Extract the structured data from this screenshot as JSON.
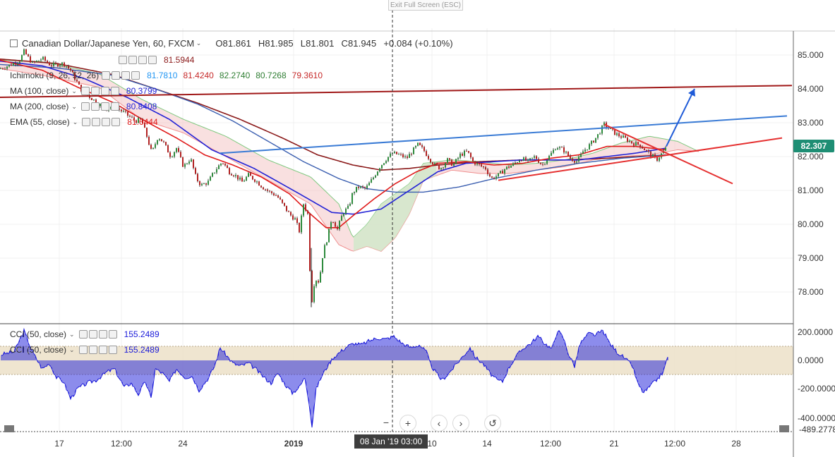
{
  "header": {
    "exit_fullscreen": "Exit Full Screen (ESC)",
    "symbol": "Canadian Dollar/Japanese Yen, 60, FXCM",
    "open": "O81.861",
    "high": "H81.985",
    "low": "L81.801",
    "close": "C81.945",
    "change": "+0.084 (+0.10%)"
  },
  "indicators": {
    "row1": {
      "value": "81.5944"
    },
    "ichimoku": {
      "name": "Ichimoku (9, 26, 52, 26)",
      "values": [
        "81.7810",
        "81.4240",
        "82.2740",
        "80.7268",
        "79.3610"
      ],
      "colors": [
        "#2196f3",
        "#c62828",
        "#2e7d32",
        "#2e7d32",
        "#c62828"
      ]
    },
    "ma100": {
      "name": "MA (100, close)",
      "value": "80.3799"
    },
    "ma200": {
      "name": "MA (200, close)",
      "value": "80.8408"
    },
    "ema55": {
      "name": "EMA (55, close)",
      "value": "81.6444"
    },
    "cci1": {
      "name": "CCI (50, close)",
      "value": "155.2489"
    },
    "cci2": {
      "name": "CCI (50, close)",
      "value": "155.2489"
    }
  },
  "price_axis": {
    "ticks": [
      "85.000",
      "84.000",
      "83.000",
      "82.000",
      "81.000",
      "80.000",
      "79.000",
      "78.000"
    ],
    "current": "82.307",
    "current_color": "#1e8e74"
  },
  "cci_axis": {
    "ticks": [
      "200.0000",
      "0.0000",
      "-200.0000",
      "-400.0000",
      "-489.2778"
    ]
  },
  "time_axis": {
    "labels": [
      "17",
      "12:00",
      "24",
      "2019",
      "10",
      "14",
      "12:00",
      "21",
      "12:00",
      "28"
    ],
    "crosshair_label": "08 Jan '19   03:00"
  },
  "nav_buttons": [
    "−",
    "+",
    "‹",
    "›",
    "↺"
  ],
  "colors": {
    "ma100": "#2323d6",
    "ma200": "#8b1a1a",
    "ema55": "#e01b1b",
    "cci": "#1a1ad9",
    "trend_blue": "#3a7bd5",
    "trend_dark": "#a01818",
    "trend_red": "#e53030",
    "band": "#ece0c8"
  },
  "chart_data": {
    "type": "candlestick",
    "instrument": "Canadian Dollar/Japanese Yen",
    "timeframe": "60",
    "ylim": [
      77.4,
      85.2
    ],
    "cci_ylim": [
      -489.2778,
      230
    ],
    "anchors": [
      [
        0,
        84.6
      ],
      [
        14,
        84.7
      ],
      [
        28,
        84.85
      ],
      [
        34,
        85.1
      ],
      [
        46,
        84.75
      ],
      [
        60,
        84.9
      ],
      [
        72,
        84.7
      ],
      [
        90,
        84.75
      ],
      [
        100,
        84.55
      ],
      [
        114,
        84.0
      ],
      [
        128,
        83.75
      ],
      [
        140,
        83.55
      ],
      [
        150,
        83.4
      ],
      [
        160,
        83.5
      ],
      [
        172,
        83.35
      ],
      [
        182,
        83.2
      ],
      [
        192,
        83.05
      ],
      [
        200,
        83.1
      ],
      [
        208,
        82.6
      ],
      [
        215,
        82.1
      ],
      [
        224,
        82.6
      ],
      [
        232,
        82.4
      ],
      [
        242,
        82.0
      ],
      [
        250,
        82.25
      ],
      [
        260,
        81.7
      ],
      [
        270,
        81.95
      ],
      [
        278,
        81.35
      ],
      [
        285,
        81.15
      ],
      [
        295,
        81.25
      ],
      [
        305,
        81.6
      ],
      [
        315,
        81.85
      ],
      [
        325,
        81.55
      ],
      [
        333,
        81.45
      ],
      [
        343,
        81.25
      ],
      [
        352,
        81.45
      ],
      [
        362,
        81.3
      ],
      [
        372,
        81.1
      ],
      [
        382,
        80.95
      ],
      [
        392,
        80.85
      ],
      [
        400,
        80.6
      ],
      [
        410,
        80.3
      ],
      [
        418,
        80.15
      ],
      [
        424,
        79.8
      ],
      [
        430,
        80.6
      ],
      [
        436,
        80.3
      ],
      [
        441,
        77.6
      ],
      [
        446,
        78.4
      ],
      [
        452,
        78.3
      ],
      [
        458,
        79.2
      ],
      [
        464,
        79.6
      ],
      [
        470,
        80.2
      ],
      [
        478,
        79.85
      ],
      [
        486,
        80.35
      ],
      [
        494,
        80.5
      ],
      [
        500,
        80.95
      ],
      [
        508,
        81.1
      ],
      [
        518,
        81.05
      ],
      [
        528,
        81.35
      ],
      [
        538,
        81.7
      ],
      [
        548,
        81.95
      ],
      [
        556,
        82.1
      ],
      [
        566,
        82.05
      ],
      [
        576,
        81.95
      ],
      [
        584,
        82.15
      ],
      [
        592,
        82.35
      ],
      [
        600,
        82.2
      ],
      [
        608,
        81.95
      ],
      [
        616,
        81.75
      ],
      [
        624,
        81.65
      ],
      [
        634,
        81.9
      ],
      [
        642,
        81.75
      ],
      [
        652,
        82.05
      ],
      [
        662,
        82.15
      ],
      [
        670,
        81.85
      ],
      [
        678,
        81.75
      ],
      [
        688,
        81.65
      ],
      [
        696,
        81.35
      ],
      [
        706,
        81.45
      ],
      [
        716,
        81.65
      ],
      [
        726,
        81.75
      ],
      [
        738,
        81.95
      ],
      [
        748,
        81.85
      ],
      [
        758,
        82.0
      ],
      [
        768,
        81.75
      ],
      [
        778,
        82.0
      ],
      [
        788,
        82.3
      ],
      [
        798,
        82.2
      ],
      [
        808,
        81.95
      ],
      [
        818,
        81.85
      ],
      [
        826,
        82.15
      ],
      [
        836,
        82.35
      ],
      [
        846,
        82.6
      ],
      [
        856,
        82.95
      ],
      [
        864,
        82.8
      ],
      [
        874,
        82.65
      ],
      [
        884,
        82.55
      ],
      [
        896,
        82.4
      ],
      [
        906,
        82.35
      ],
      [
        914,
        82.2
      ],
      [
        922,
        82.05
      ],
      [
        930,
        81.9
      ],
      [
        936,
        82.05
      ],
      [
        944,
        82.25
      ]
    ],
    "cci_anchors": [
      [
        0,
        40
      ],
      [
        20,
        60
      ],
      [
        34,
        210
      ],
      [
        46,
        60
      ],
      [
        60,
        -60
      ],
      [
        70,
        -20
      ],
      [
        80,
        -120
      ],
      [
        90,
        -150
      ],
      [
        100,
        -270
      ],
      [
        110,
        -200
      ],
      [
        124,
        -160
      ],
      [
        136,
        -140
      ],
      [
        152,
        -80
      ],
      [
        162,
        -60
      ],
      [
        176,
        -190
      ],
      [
        186,
        -160
      ],
      [
        196,
        -240
      ],
      [
        206,
        -150
      ],
      [
        214,
        -270
      ],
      [
        220,
        -60
      ],
      [
        230,
        -90
      ],
      [
        240,
        -150
      ],
      [
        250,
        -60
      ],
      [
        262,
        -120
      ],
      [
        272,
        -110
      ],
      [
        282,
        -210
      ],
      [
        296,
        -120
      ],
      [
        304,
        -40
      ],
      [
        312,
        90
      ],
      [
        320,
        40
      ],
      [
        330,
        -20
      ],
      [
        340,
        -40
      ],
      [
        352,
        -20
      ],
      [
        362,
        -60
      ],
      [
        374,
        -120
      ],
      [
        384,
        -160
      ],
      [
        394,
        -90
      ],
      [
        404,
        -170
      ],
      [
        414,
        -230
      ],
      [
        424,
        -190
      ],
      [
        432,
        -120
      ],
      [
        438,
        -300
      ],
      [
        442,
        -470
      ],
      [
        448,
        -200
      ],
      [
        456,
        -110
      ],
      [
        464,
        -40
      ],
      [
        472,
        20
      ],
      [
        482,
        60
      ],
      [
        492,
        100
      ],
      [
        502,
        120
      ],
      [
        512,
        110
      ],
      [
        524,
        140
      ],
      [
        536,
        160
      ],
      [
        546,
        150
      ],
      [
        558,
        170
      ],
      [
        570,
        120
      ],
      [
        582,
        90
      ],
      [
        594,
        110
      ],
      [
        604,
        60
      ],
      [
        610,
        -30
      ],
      [
        618,
        -90
      ],
      [
        626,
        -140
      ],
      [
        636,
        -90
      ],
      [
        646,
        -30
      ],
      [
        656,
        30
      ],
      [
        666,
        90
      ],
      [
        674,
        20
      ],
      [
        684,
        -20
      ],
      [
        694,
        -90
      ],
      [
        704,
        -140
      ],
      [
        712,
        -150
      ],
      [
        720,
        -60
      ],
      [
        730,
        20
      ],
      [
        742,
        90
      ],
      [
        752,
        120
      ],
      [
        762,
        170
      ],
      [
        772,
        120
      ],
      [
        782,
        80
      ],
      [
        790,
        215
      ],
      [
        798,
        160
      ],
      [
        806,
        40
      ],
      [
        814,
        -40
      ],
      [
        822,
        120
      ],
      [
        834,
        190
      ],
      [
        844,
        180
      ],
      [
        854,
        210
      ],
      [
        864,
        120
      ],
      [
        874,
        60
      ],
      [
        884,
        20
      ],
      [
        896,
        -40
      ],
      [
        904,
        -170
      ],
      [
        912,
        -230
      ],
      [
        920,
        -190
      ],
      [
        930,
        -140
      ],
      [
        940,
        -80
      ],
      [
        946,
        30
      ]
    ],
    "ma100": [
      [
        0,
        84.82
      ],
      [
        60,
        84.68
      ],
      [
        120,
        84.3
      ],
      [
        180,
        83.75
      ],
      [
        240,
        83.1
      ],
      [
        300,
        82.2
      ],
      [
        360,
        81.65
      ],
      [
        420,
        80.95
      ],
      [
        470,
        80.35
      ],
      [
        500,
        80.3
      ],
      [
        540,
        80.45
      ],
      [
        580,
        81.0
      ],
      [
        620,
        81.55
      ],
      [
        660,
        81.8
      ],
      [
        700,
        81.85
      ],
      [
        740,
        81.9
      ],
      [
        780,
        81.9
      ],
      [
        820,
        81.9
      ],
      [
        860,
        82.0
      ],
      [
        900,
        82.1
      ],
      [
        944,
        82.25
      ]
    ],
    "ma200": [
      [
        0,
        84.88
      ],
      [
        80,
        84.75
      ],
      [
        160,
        84.42
      ],
      [
        220,
        84.0
      ],
      [
        280,
        83.58
      ],
      [
        340,
        83.1
      ],
      [
        400,
        82.55
      ],
      [
        450,
        82.05
      ],
      [
        500,
        81.75
      ],
      [
        540,
        81.6
      ],
      [
        580,
        81.65
      ],
      [
        620,
        81.75
      ],
      [
        680,
        81.85
      ],
      [
        740,
        81.9
      ],
      [
        800,
        81.9
      ],
      [
        860,
        81.95
      ],
      [
        944,
        82.05
      ]
    ],
    "ma_blue_slow": [
      [
        0,
        84.72
      ],
      [
        80,
        84.62
      ],
      [
        160,
        84.4
      ],
      [
        220,
        84.0
      ],
      [
        280,
        83.55
      ],
      [
        330,
        83.05
      ],
      [
        380,
        82.45
      ],
      [
        430,
        81.85
      ],
      [
        480,
        81.35
      ],
      [
        520,
        81.05
      ],
      [
        560,
        80.95
      ],
      [
        600,
        80.95
      ],
      [
        650,
        81.1
      ],
      [
        700,
        81.35
      ],
      [
        760,
        81.6
      ],
      [
        820,
        81.8
      ],
      [
        880,
        81.95
      ],
      [
        944,
        82.05
      ]
    ],
    "ema55": [
      [
        0,
        84.85
      ],
      [
        60,
        84.55
      ],
      [
        110,
        84.05
      ],
      [
        160,
        83.6
      ],
      [
        210,
        83.0
      ],
      [
        250,
        82.55
      ],
      [
        290,
        82.05
      ],
      [
        330,
        81.75
      ],
      [
        370,
        81.4
      ],
      [
        410,
        80.9
      ],
      [
        440,
        80.3
      ],
      [
        462,
        79.9
      ],
      [
        480,
        79.9
      ],
      [
        500,
        80.25
      ],
      [
        530,
        80.75
      ],
      [
        560,
        81.2
      ],
      [
        590,
        81.55
      ],
      [
        620,
        81.8
      ],
      [
        660,
        81.85
      ],
      [
        700,
        81.75
      ],
      [
        740,
        81.8
      ],
      [
        780,
        81.95
      ],
      [
        820,
        82.05
      ],
      [
        860,
        82.3
      ],
      [
        900,
        82.3
      ],
      [
        944,
        82.2
      ]
    ],
    "cloud_green": [
      [
        0,
        84.85
      ],
      [
        60,
        84.8
      ],
      [
        140,
        84.45
      ],
      [
        200,
        83.7
      ],
      [
        260,
        83.1
      ],
      [
        320,
        82.6
      ],
      [
        380,
        81.9
      ],
      [
        440,
        81.4
      ],
      [
        480,
        80.6
      ],
      [
        500,
        79.6
      ],
      [
        520,
        80.0
      ],
      [
        540,
        80.6
      ],
      [
        560,
        80.9
      ],
      [
        580,
        81.2
      ],
      [
        600,
        81.8
      ],
      [
        640,
        81.9
      ],
      [
        680,
        81.85
      ],
      [
        720,
        81.75
      ],
      [
        760,
        81.8
      ],
      [
        800,
        81.9
      ],
      [
        840,
        82.1
      ],
      [
        880,
        82.4
      ],
      [
        920,
        82.6
      ],
      [
        960,
        82.45
      ],
      [
        990,
        82.15
      ]
    ],
    "cloud_red": [
      [
        0,
        84.6
      ],
      [
        60,
        84.4
      ],
      [
        140,
        84.05
      ],
      [
        200,
        83.1
      ],
      [
        260,
        82.7
      ],
      [
        320,
        82.0
      ],
      [
        380,
        81.3
      ],
      [
        440,
        80.6
      ],
      [
        480,
        79.4
      ],
      [
        500,
        79.2
      ],
      [
        520,
        79.35
      ],
      [
        540,
        79.2
      ],
      [
        560,
        79.6
      ],
      [
        580,
        80.3
      ],
      [
        600,
        81.3
      ],
      [
        640,
        81.6
      ],
      [
        680,
        81.5
      ],
      [
        720,
        81.5
      ],
      [
        760,
        81.6
      ],
      [
        800,
        81.7
      ],
      [
        840,
        81.9
      ],
      [
        880,
        82.0
      ],
      [
        920,
        82.05
      ],
      [
        960,
        82.2
      ],
      [
        990,
        82.15
      ]
    ],
    "trendlines": [
      {
        "color": "#3a7bd5",
        "from": [
          312,
          82.1
        ],
        "to": [
          1115,
          83.2
        ]
      },
      {
        "color": "#a01818",
        "from": [
          0,
          83.75
        ],
        "to": [
          1122,
          84.1
        ]
      },
      {
        "color": "#e53030",
        "from": [
          706,
          81.3
        ],
        "to": [
          1108,
          82.55
        ]
      },
      {
        "color": "#e53030",
        "from": [
          856,
          82.95
        ],
        "to": [
          1038,
          81.2
        ]
      }
    ],
    "arrow": {
      "color": "#1f5bd8",
      "from": [
        944,
        82.3
      ],
      "to": [
        984,
        84.0
      ]
    }
  }
}
